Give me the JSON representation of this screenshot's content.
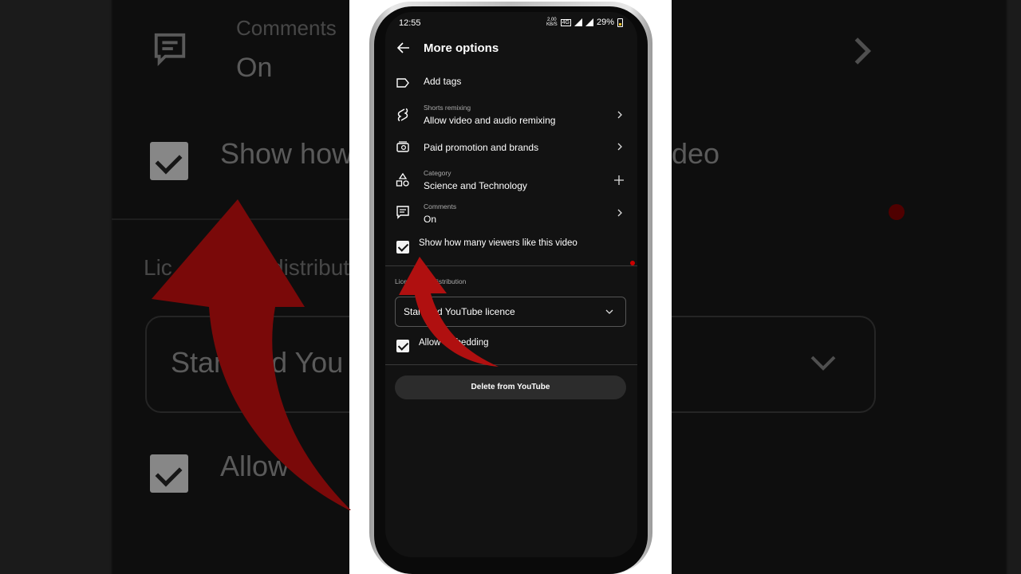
{
  "status_bar": {
    "time": "12:55",
    "net_speed_top": "2.00",
    "net_speed_unit": "KB/S",
    "network_badge": "4G",
    "battery": "29%"
  },
  "header": {
    "title": "More options"
  },
  "rows": {
    "add_tags": {
      "label": "Add tags"
    },
    "remixing": {
      "sub": "Shorts remixing",
      "label": "Allow video and audio remixing"
    },
    "paid_promotion": {
      "label": "Paid promotion and brands"
    },
    "category": {
      "sub": "Category",
      "label": "Science and Technology"
    },
    "comments": {
      "sub": "Comments",
      "label": "On"
    },
    "show_likes": {
      "label": "Show how many viewers like this video",
      "checked": true
    }
  },
  "licence": {
    "section_label": "Licence and distribution",
    "select_value": "Standard YouTube licence",
    "embedding_label": "Allow embedding",
    "embedding_checked": true
  },
  "delete_button": {
    "label": "Delete from YouTube"
  },
  "background": {
    "comments_title": "Comments",
    "comments_value": "On",
    "show_how_text": "Show how",
    "video_text": "deo",
    "licence_text": "Lic",
    "distribution_text": "distribution",
    "standard_text": "Standard You",
    "allow_text": "Allow"
  },
  "colors": {
    "accent_arrow": "#8b0a0a",
    "screen_bg": "#121212",
    "text": "#ffffff",
    "secondary_text": "#aaaaaa"
  }
}
